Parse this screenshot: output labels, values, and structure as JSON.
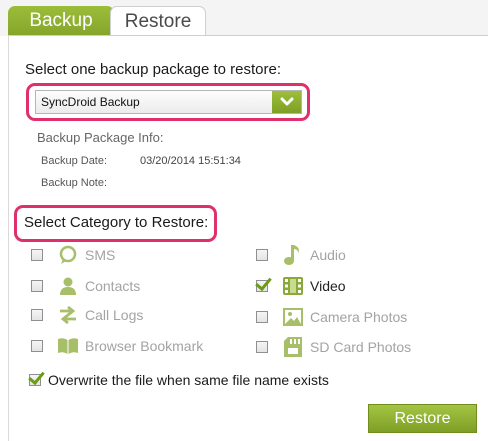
{
  "tabs": [
    {
      "label": "Backup"
    },
    {
      "label": "Restore"
    }
  ],
  "restore": {
    "prompt": "Select one backup package to restore:",
    "package_select": {
      "selected": "SyncDroid Backup"
    },
    "info_heading": "Backup Package Info:",
    "backup_date_label": "Backup Date:",
    "backup_date_value": "03/20/2014 15:51:34",
    "backup_note_label": "Backup Note:",
    "backup_note_value": ""
  },
  "categories": {
    "title": "Select Category to Restore:",
    "items": [
      {
        "label": "SMS",
        "icon": "sms-bubble-icon",
        "checked": false,
        "enabled": false
      },
      {
        "label": "Contacts",
        "icon": "contact-person-icon",
        "checked": false,
        "enabled": false
      },
      {
        "label": "Call Logs",
        "icon": "call-log-arrows-icon",
        "checked": false,
        "enabled": false
      },
      {
        "label": "Browser Bookmark",
        "icon": "book-icon",
        "checked": false,
        "enabled": false
      },
      {
        "label": "Audio",
        "icon": "music-note-icon",
        "checked": false,
        "enabled": false
      },
      {
        "label": "Video",
        "icon": "film-icon",
        "checked": true,
        "enabled": true
      },
      {
        "label": "Camera Photos",
        "icon": "photo-icon",
        "checked": false,
        "enabled": false
      },
      {
        "label": "SD Card Photos",
        "icon": "sd-card-icon",
        "checked": false,
        "enabled": false
      }
    ]
  },
  "overwrite": {
    "label": "Overwrite the file when same file name exists",
    "checked": true
  },
  "restore_button": {
    "label": "Restore"
  },
  "colors": {
    "accent": "#8fb030",
    "highlight": "#e0306a",
    "icon_disabled": "#a8bf6a",
    "icon_enabled": "#8aa93a"
  }
}
